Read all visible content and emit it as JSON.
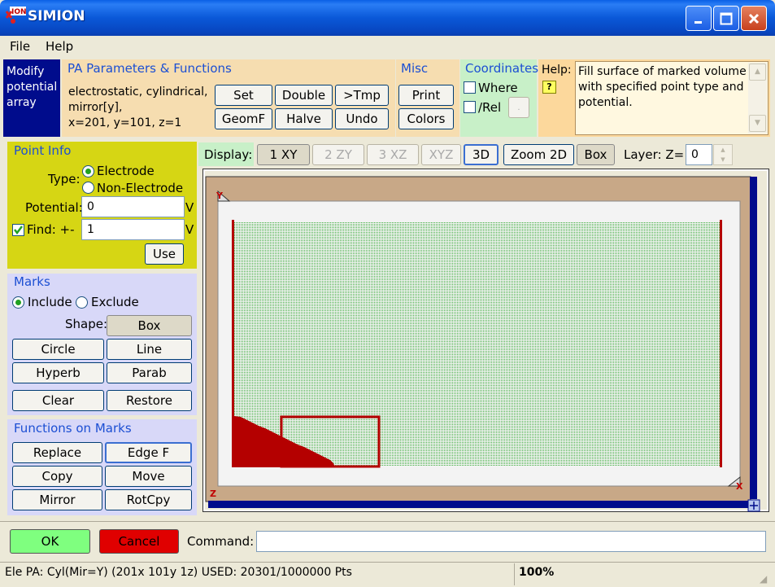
{
  "window": {
    "title": "SIMION",
    "logo_text": "ION"
  },
  "menu": {
    "file": "File",
    "help": "Help"
  },
  "mode_panel": {
    "label": "Modify potential array"
  },
  "pa_params": {
    "title": "PA Parameters & Functions",
    "description_lines": [
      "electrostatic, cylindrical,",
      "mirror[y],",
      "x=201, y=101, z=1"
    ],
    "buttons": {
      "set": "Set",
      "double": "Double",
      "tmp": ">Tmp",
      "geomf": "GeomF",
      "halve": "Halve",
      "undo": "Undo"
    }
  },
  "misc": {
    "title": "Misc",
    "print": "Print",
    "colors": "Colors"
  },
  "coordinates": {
    "title": "Coordinates",
    "where": "Where",
    "rel": "/Rel",
    "small_btn": "."
  },
  "help": {
    "label": "Help:",
    "button": "?",
    "text": "Fill surface of marked volume with specified point type and potential."
  },
  "point_info": {
    "title": "Point Info",
    "type_label": "Type:",
    "electrode": "Electrode",
    "non_electrode": "Non-Electrode",
    "potential_label": "Potential:",
    "potential_value": "0",
    "potential_unit": "V",
    "find_label": "Find:  +-",
    "find_value": "1",
    "find_unit": "V",
    "use": "Use"
  },
  "marks": {
    "title": "Marks",
    "include": "Include",
    "exclude": "Exclude",
    "shape_label": "Shape:",
    "box": "Box",
    "circle": "Circle",
    "line": "Line",
    "hyperb": "Hyperb",
    "parab": "Parab",
    "clear": "Clear",
    "restore": "Restore"
  },
  "functions": {
    "title": "Functions on Marks",
    "replace": "Replace",
    "edge_f": "Edge F",
    "copy": "Copy",
    "move": "Move",
    "mirror": "Mirror",
    "rotcpy": "RotCpy"
  },
  "display": {
    "label": "Display:",
    "xy": "1 XY",
    "zy": "2 ZY",
    "xz": "3 XZ",
    "xyz": "XYZ",
    "three_d": "3D",
    "zoom2d": "Zoom 2D",
    "box": "Box",
    "layer_label": "Layer: Z=",
    "layer_value": "0"
  },
  "axes": {
    "y": "Y",
    "x": "X",
    "z": "Z"
  },
  "bottom": {
    "ok": "OK",
    "cancel": "Cancel",
    "command_label": "Command:",
    "command_value": ""
  },
  "status": {
    "info": "Ele PA: Cyl(Mir=Y) (201x 101y 1z)  USED: 20301/1000000 Pts",
    "zoom": "100%"
  },
  "colors": {
    "electrode": "#b40000",
    "grid_dots": "#3fae3f",
    "frame_tan": "#c8a887",
    "scroll_blue": "#000c8c",
    "ok_green": "#7fff7f",
    "cancel_red": "#e00000",
    "point_info_bg": "#d6d614",
    "marks_bg": "#d8d8f8"
  }
}
